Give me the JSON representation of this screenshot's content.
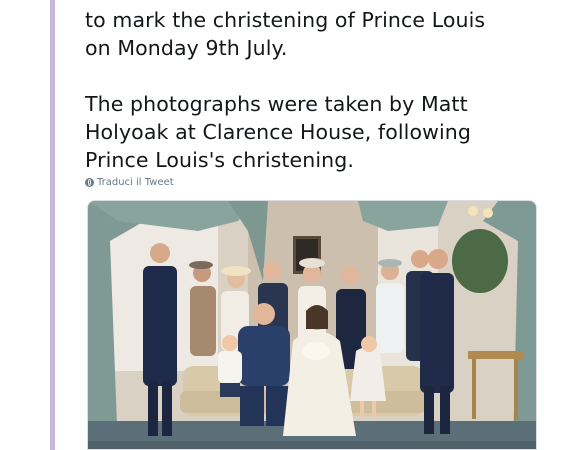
{
  "tweet": {
    "lines": [
      "to mark the christening of Prince Louis",
      "on Monday 9th July.",
      "The photographs were taken by Matt",
      "Holyoak at Clarence House, following",
      "Prince Louis's christening."
    ],
    "clipped_top_line": "",
    "translate_label": "Traduci il Tweet",
    "translate_icon": "globe-icon"
  },
  "photo": {
    "subject": "family-portrait-photo"
  },
  "colors": {
    "thread_line": "#c8b8de",
    "text": "#14171a",
    "meta": "#657786"
  }
}
